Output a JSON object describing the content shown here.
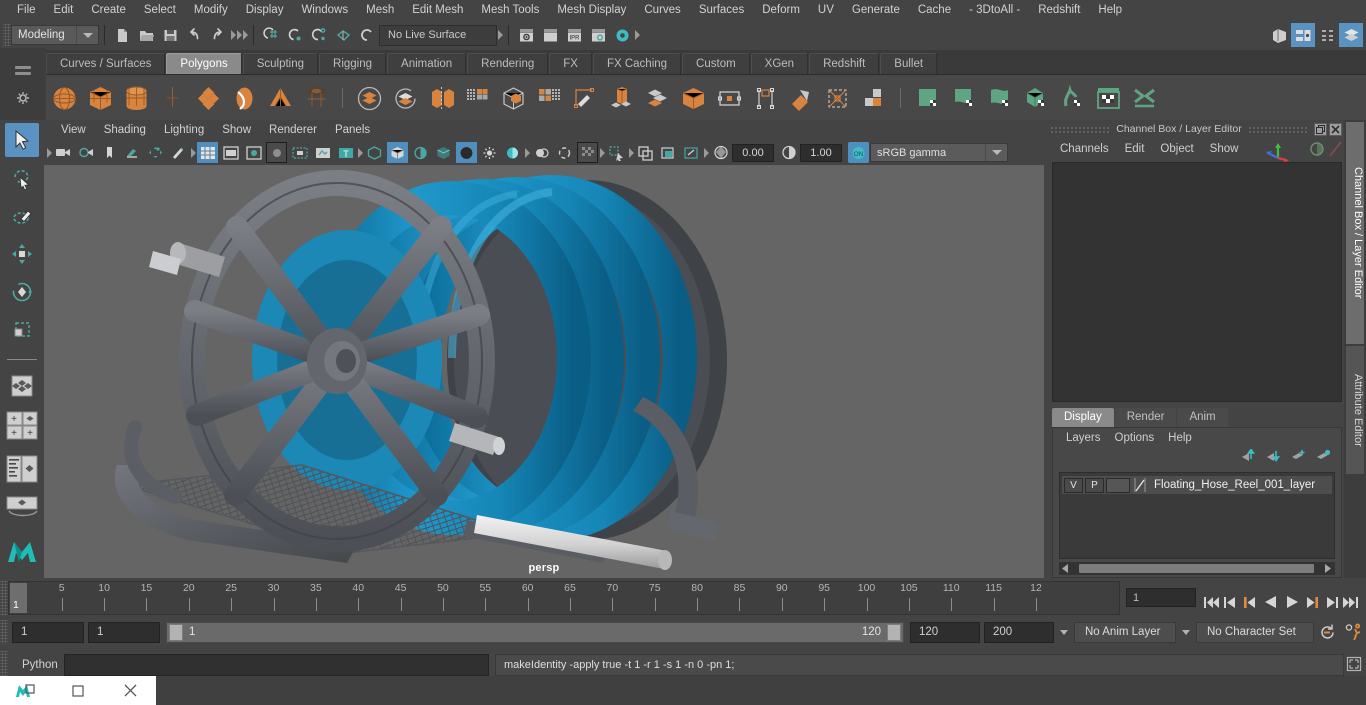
{
  "menubar": {
    "items": [
      "File",
      "Edit",
      "Create",
      "Select",
      "Modify",
      "Display",
      "Windows",
      "Mesh",
      "Edit Mesh",
      "Mesh Tools",
      "Mesh Display",
      "Curves",
      "Surfaces",
      "Deform",
      "UV",
      "Generate",
      "Cache",
      "- 3DtoAll -",
      "Redshift",
      "Help"
    ]
  },
  "status": {
    "mode": "Modeling",
    "live_surface": "No Live Surface",
    "icons": [
      "new-scene-icon",
      "open-scene-icon",
      "save-scene-icon",
      "undo-icon",
      "redo-icon",
      "select-by-hierarchy-icon",
      "select-by-object-icon",
      "select-by-component-icon",
      "snap-to-grid-icon",
      "snap-to-curve-icon",
      "snap-to-point-icon",
      "snap-to-projected-center-icon",
      "snap-to-view-plane-icon",
      "render-current-frame-icon",
      "render-sequence-icon",
      "ipr-render-icon",
      "render-settings-icon",
      "hypershade-icon"
    ],
    "right_icons": [
      "show-hide-modeling-toolkit-icon",
      "show-hide-attribute-editor-icon",
      "show-hide-tool-settings-icon",
      "show-hide-channel-box-icon"
    ]
  },
  "shelf": {
    "tabs": [
      "Curves / Surfaces",
      "Polygons",
      "Sculpting",
      "Rigging",
      "Animation",
      "Rendering",
      "FX",
      "FX Caching",
      "Custom",
      "XGen",
      "Redshift",
      "Bullet"
    ],
    "active_tab": "Polygons",
    "buttons": [
      "polygon-sphere-icon",
      "polygon-cube-icon",
      "polygon-cylinder-icon",
      "polygon-cone-icon",
      "polygon-torus-icon",
      "polygon-plane-icon",
      "polygon-pyramid-icon",
      "polygon-pipe-icon",
      "combine-icon",
      "separate-icon",
      "extract-icon",
      "mirror-geometry-icon",
      "booleans-icon",
      "smooth-icon",
      "quad-draw-icon",
      "extrude-icon",
      "bevel-icon",
      "bridge-icon",
      "append-polygon-icon",
      "insert-edge-loop-icon",
      "offset-edge-loop-icon",
      "multi-cut-icon",
      "target-weld-icon",
      "merge-icon",
      "sculpt-tool-icon",
      "sculpt-smooth-icon",
      "sculpt-relax-icon",
      "sculpt-grab-icon",
      "sculpt-pinch-icon",
      "sculpt-flatten-icon",
      "sculpt-foamy-icon"
    ]
  },
  "toolbox": {
    "tools": [
      {
        "name": "select-tool",
        "selected": true
      },
      {
        "name": "lasso-select-tool",
        "selected": false
      },
      {
        "name": "paint-select-tool",
        "selected": false
      },
      {
        "name": "move-tool",
        "selected": false
      },
      {
        "name": "rotate-tool",
        "selected": false
      },
      {
        "name": "scale-tool",
        "selected": false
      },
      {
        "name": "last-tool-used",
        "selected": false
      },
      {
        "name": "single-perspective-layout",
        "selected": false
      },
      {
        "name": "four-view-layout",
        "selected": false
      },
      {
        "name": "persp-outliner-layout",
        "selected": false
      },
      {
        "name": "persp-graph-layout",
        "selected": false
      },
      {
        "name": "maya-logo-icon",
        "selected": false
      }
    ]
  },
  "viewport": {
    "menu": [
      "View",
      "Shading",
      "Lighting",
      "Show",
      "Renderer",
      "Panels"
    ],
    "camera_label": "persp",
    "exposure": "0.00",
    "gamma": "1.00",
    "color_space": "sRGB gamma",
    "toolbar_icons": [
      "select-camera-icon",
      "camera-attributes-icon",
      "bookmark-icon",
      "image-plane-icon",
      "two-d-pan-zoom-icon",
      "grease-pencil-icon",
      "grid-toggle-icon",
      "film-gate-icon",
      "resolution-gate-icon",
      "gate-mask-icon",
      "film-origin-icon",
      "xray-icon",
      "xray-joints-icon",
      "wireframe-icon",
      "smooth-shade-all-icon",
      "shaded-wireframe-icon",
      "use-default-material-icon",
      "textured-icon",
      "lights-icon",
      "shadows-icon",
      "screen-space-ao-icon",
      "motion-blur-icon",
      "multisample-aa-icon",
      "depth-of-field-icon",
      "isolate-select-icon",
      "xray-active-components-icon",
      "xray-joints2-icon",
      "viewport-display-icon",
      "exposure-icon",
      "gamma-icon",
      "color-management-icon"
    ],
    "model": {
      "name": "Floating Hose Reel",
      "hose_color": "#1e90c0",
      "frame_color": "#5e6168",
      "background_color": "#656565"
    }
  },
  "channel_box": {
    "title": "Channel Box / Layer Editor",
    "menu": [
      "Channels",
      "Edit",
      "Object",
      "Show"
    ],
    "window_buttons": [
      "restore-button",
      "close-button"
    ]
  },
  "layer_editor": {
    "tabs": [
      "Display",
      "Render",
      "Anim"
    ],
    "active_tab": "Display",
    "menu": [
      "Layers",
      "Options",
      "Help"
    ],
    "toolbar_icons": [
      "move-layer-up-icon",
      "move-layer-down-icon",
      "new-layer-from-selected-icon",
      "new-layer-icon"
    ],
    "layers": [
      {
        "visibility": "V",
        "playback": "P",
        "shading": "",
        "name": "Floating_Hose_Reel_001_layer"
      }
    ]
  },
  "right_tabs": {
    "items": [
      "Channel Box / Layer Editor",
      "Attribute Editor"
    ],
    "active": "Channel Box / Layer Editor"
  },
  "timeline": {
    "tick_labels": [
      "5",
      "10",
      "15",
      "20",
      "25",
      "30",
      "35",
      "40",
      "45",
      "50",
      "55",
      "60",
      "65",
      "70",
      "75",
      "80",
      "85",
      "90",
      "95",
      "100",
      "105",
      "110",
      "115",
      "12"
    ],
    "current_frame": "1",
    "current_frame_field": "1",
    "playback_buttons": [
      "go-to-start-icon",
      "step-back-keyframe-icon",
      "step-back-frame-icon",
      "play-backwards-icon",
      "play-forwards-icon",
      "step-forward-frame-icon",
      "step-forward-keyframe-icon",
      "go-to-end-icon"
    ]
  },
  "range": {
    "anim_start": "1",
    "range_start": "1",
    "slider_start_label": "1",
    "slider_end_label": "120",
    "range_end": "120",
    "anim_end": "200",
    "anim_layer": "No Anim Layer",
    "character_set": "No Character Set",
    "right_icons": [
      "auto-key-icon",
      "animation-preferences-icon"
    ]
  },
  "command_line": {
    "language_label": "Python",
    "input_value": "",
    "output_text": "makeIdentity -apply true -t 1 -r 1 -s 1 -n 0 -pn 1;",
    "script_editor_icon": "script-editor-icon"
  },
  "taskbar": {
    "buttons": [
      "maya-restore-icon",
      "minimize-icon",
      "close-icon"
    ]
  },
  "colors": {
    "accent_blue": "#5a92c2",
    "shelf_orange": "#d8833e",
    "teal": "#4ba9a4",
    "green": "#5fa583",
    "panel_bg": "#444444",
    "viewport_bg": "#656565"
  }
}
